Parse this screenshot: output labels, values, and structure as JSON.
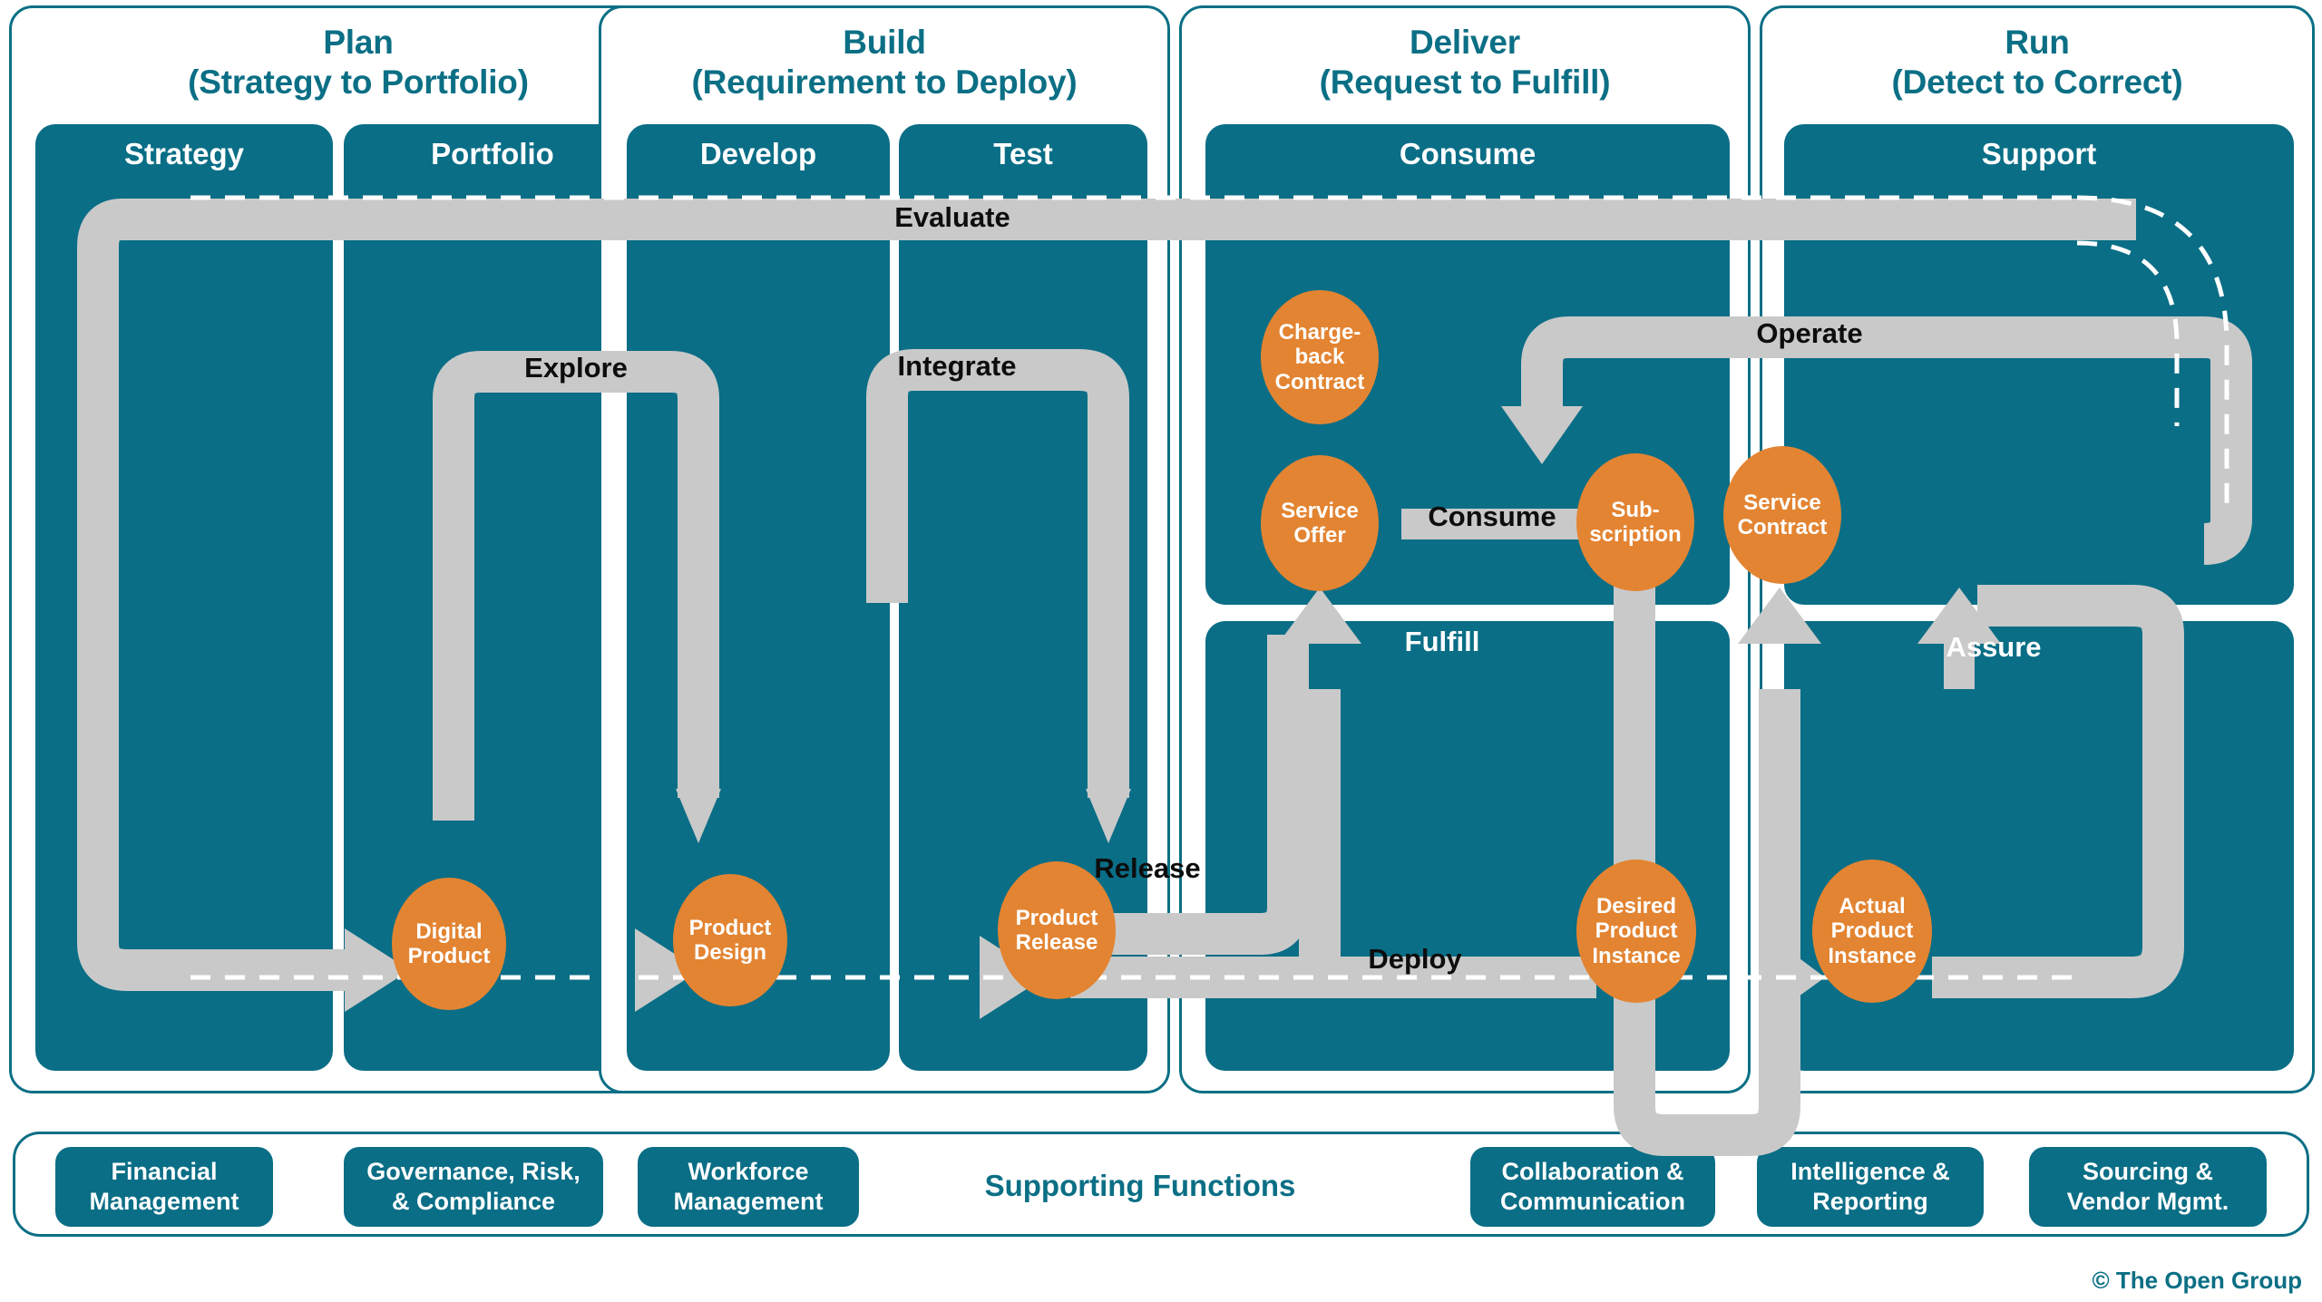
{
  "colors": {
    "teal": "#0a6e86",
    "teal_border": "#0b6f85",
    "orange": "#e38432",
    "ribbon": "#c9c9c9",
    "white": "#ffffff",
    "label_dark": "#0d0d0d"
  },
  "phases": [
    {
      "name": "Plan",
      "subtitle": "(Strategy to Portfolio)",
      "stages": [
        "Strategy",
        "Portfolio"
      ]
    },
    {
      "name": "Build",
      "subtitle": "(Requirement to Deploy)",
      "stages": [
        "Develop",
        "Test"
      ]
    },
    {
      "name": "Deliver",
      "subtitle": "(Request to Fulfill)",
      "stages": [
        "Consume",
        "Fulfill"
      ]
    },
    {
      "name": "Run",
      "subtitle": "(Detect to Correct)",
      "stages": [
        "Support",
        "Assure"
      ]
    }
  ],
  "nodes": [
    {
      "id": "digital-product",
      "lines": [
        "Digital",
        "Product"
      ]
    },
    {
      "id": "product-design",
      "lines": [
        "Product",
        "Design"
      ]
    },
    {
      "id": "product-release",
      "lines": [
        "Product",
        "Release"
      ]
    },
    {
      "id": "chargeback-contract",
      "lines": [
        "Charge-",
        "back",
        "Contract"
      ]
    },
    {
      "id": "service-offer",
      "lines": [
        "Service",
        "Offer"
      ]
    },
    {
      "id": "subscription",
      "lines": [
        "Sub-",
        "scription"
      ]
    },
    {
      "id": "service-contract",
      "lines": [
        "Service",
        "Contract"
      ]
    },
    {
      "id": "desired-product-instance",
      "lines": [
        "Desired",
        "Product",
        "Instance"
      ]
    },
    {
      "id": "actual-product-instance",
      "lines": [
        "Actual",
        "Product",
        "Instance"
      ]
    }
  ],
  "flows": [
    {
      "id": "evaluate",
      "label": "Evaluate"
    },
    {
      "id": "explore",
      "label": "Explore"
    },
    {
      "id": "integrate",
      "label": "Integrate"
    },
    {
      "id": "release",
      "label": "Release"
    },
    {
      "id": "deploy",
      "label": "Deploy"
    },
    {
      "id": "consume",
      "label": "Consume"
    },
    {
      "id": "operate",
      "label": "Operate"
    },
    {
      "id": "fulfill",
      "label": "Fulfill"
    },
    {
      "id": "assure",
      "label": "Assure"
    }
  ],
  "supporting": {
    "title": "Supporting Functions",
    "left_chips": [
      {
        "lines": [
          "Financial",
          "Management"
        ]
      },
      {
        "lines": [
          "Governance, Risk,",
          "& Compliance"
        ]
      },
      {
        "lines": [
          "Workforce",
          "Management"
        ]
      }
    ],
    "right_chips": [
      {
        "lines": [
          "Collaboration &",
          "Communication"
        ]
      },
      {
        "lines": [
          "Intelligence &",
          "Reporting"
        ]
      },
      {
        "lines": [
          "Sourcing &",
          "Vendor Mgmt."
        ]
      }
    ]
  },
  "copyright": "© The Open Group"
}
